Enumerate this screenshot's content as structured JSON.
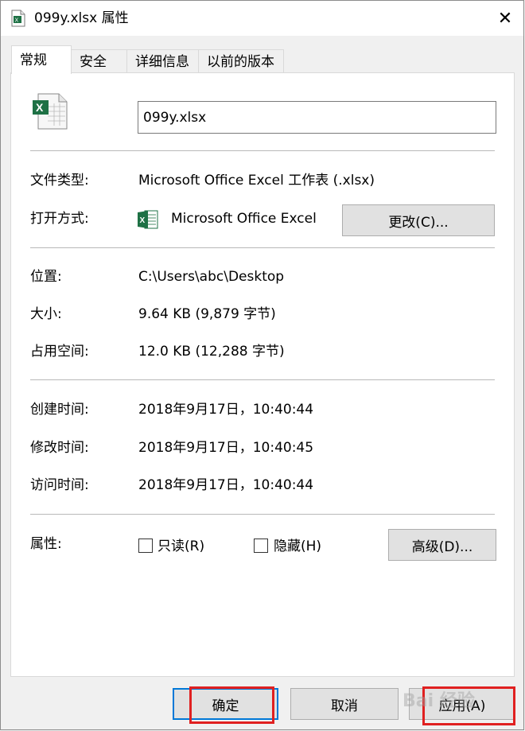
{
  "window": {
    "title": "099y.xlsx 属性",
    "close_glyph": "✕"
  },
  "tabs": [
    {
      "label": "常规",
      "active": true
    },
    {
      "label": "安全"
    },
    {
      "label": "详细信息"
    },
    {
      "label": "以前的版本"
    }
  ],
  "general": {
    "filename": "099y.xlsx",
    "type_label": "文件类型:",
    "type_value": "Microsoft Office Excel 工作表 (.xlsx)",
    "opens_label": "打开方式:",
    "opens_value": "Microsoft Office Excel",
    "change_button": "更改(C)...",
    "location_label": "位置:",
    "location_value": "C:\\Users\\abc\\Desktop",
    "size_label": "大小:",
    "size_value": "9.64 KB (9,879 字节)",
    "disk_label": "占用空间:",
    "disk_value": "12.0 KB (12,288 字节)",
    "created_label": "创建时间:",
    "created_value": "2018年9月17日，10:40:44",
    "modified_label": "修改时间:",
    "modified_value": "2018年9月17日，10:40:45",
    "accessed_label": "访问时间:",
    "accessed_value": "2018年9月17日，10:40:44",
    "attr_label": "属性:",
    "readonly_label": "只读(R)",
    "hidden_label": "隐藏(H)",
    "advanced_button": "高级(D)..."
  },
  "footer": {
    "ok": "确定",
    "cancel": "取消",
    "apply": "应用(A)"
  },
  "watermark": "Bai 经验"
}
